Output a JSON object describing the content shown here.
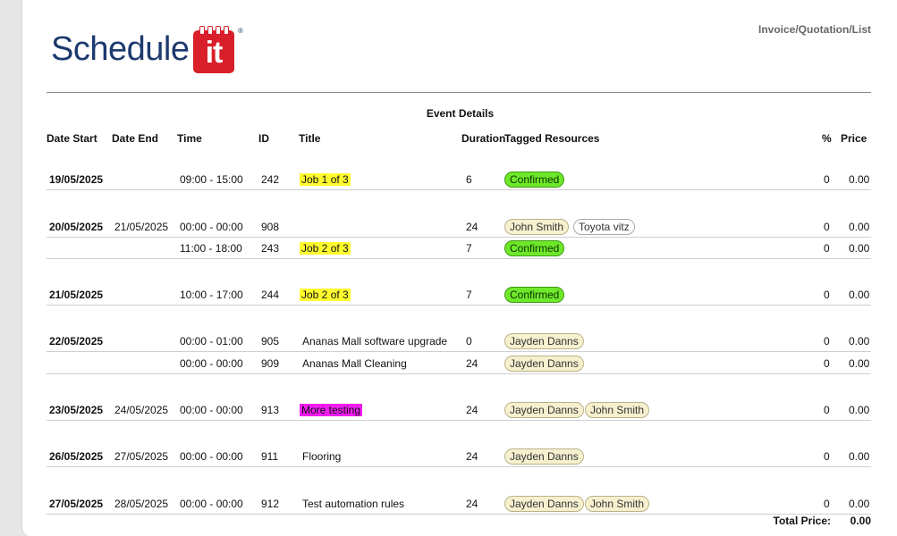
{
  "header": {
    "doc_type": "Invoice/Quotation/List",
    "logo_text": "Schedule",
    "logo_box_text": "it",
    "logo_reg": "®"
  },
  "section_title": "Event Details",
  "columns": {
    "date_start": "Date Start",
    "date_end": "Date End",
    "time": "Time",
    "id": "ID",
    "title": "Title",
    "duration": "Duration",
    "tagged": "Tagged Resources",
    "pct": "%",
    "price": "Price"
  },
  "rows": [
    {
      "date_start": "19/05/2025",
      "date_end": "",
      "time": "09:00 - 15:00",
      "id": "242",
      "title": "Job 1 of 3",
      "title_hl": "yellow",
      "duration": "6",
      "tags": [
        {
          "text": "Confirmed",
          "style": "green"
        }
      ],
      "pct": "0",
      "price": "0.00"
    },
    {
      "date_start": "20/05/2025",
      "date_end": "21/05/2025",
      "time": "00:00 - 00:00",
      "id": "908",
      "title": "",
      "title_hl": "",
      "duration": "24",
      "tags": [
        {
          "text": "John Smith",
          "style": "beige"
        },
        {
          "text": "Toyota vitz",
          "style": "white"
        }
      ],
      "pct": "0",
      "price": "0.00"
    },
    {
      "date_start": "",
      "date_end": "",
      "time": "11:00 - 18:00",
      "id": "243",
      "title": "Job 2 of 3",
      "title_hl": "yellow",
      "duration": "7",
      "tags": [
        {
          "text": "Confirmed",
          "style": "green"
        }
      ],
      "pct": "0",
      "price": "0.00"
    },
    {
      "date_start": "21/05/2025",
      "date_end": "",
      "time": "10:00 - 17:00",
      "id": "244",
      "title": "Job 2 of 3",
      "title_hl": "yellow",
      "duration": "7",
      "tags": [
        {
          "text": "Confirmed",
          "style": "green"
        }
      ],
      "pct": "0",
      "price": "0.00"
    },
    {
      "date_start": "22/05/2025",
      "date_end": "",
      "time": "00:00 - 01:00",
      "id": "905",
      "title": "Ananas Mall software upgrade",
      "title_hl": "",
      "duration": "0",
      "tags": [
        {
          "text": "Jayden Danns",
          "style": "beige"
        }
      ],
      "pct": "0",
      "price": "0.00"
    },
    {
      "date_start": "",
      "date_end": "",
      "time": "00:00 - 00:00",
      "id": "909",
      "title": "Ananas Mall Cleaning",
      "title_hl": "",
      "duration": "24",
      "tags": [
        {
          "text": "Jayden Danns",
          "style": "beige"
        }
      ],
      "pct": "0",
      "price": "0.00"
    },
    {
      "date_start": "23/05/2025",
      "date_end": "24/05/2025",
      "time": "00:00 - 00:00",
      "id": "913",
      "title": "More testing",
      "title_hl": "magenta",
      "duration": "24",
      "tags": [
        {
          "text": "Jayden Danns",
          "style": "beige"
        },
        {
          "text": "John Smith",
          "style": "beige"
        }
      ],
      "pct": "0",
      "price": "0.00"
    },
    {
      "date_start": "26/05/2025",
      "date_end": "27/05/2025",
      "time": "00:00 - 00:00",
      "id": "911",
      "title": "Flooring",
      "title_hl": "",
      "duration": "24",
      "tags": [
        {
          "text": "Jayden Danns",
          "style": "beige"
        }
      ],
      "pct": "0",
      "price": "0.00"
    },
    {
      "date_start": "27/05/2025",
      "date_end": "28/05/2025",
      "time": "00:00 - 00:00",
      "id": "912",
      "title": "Test automation rules",
      "title_hl": "",
      "duration": "24",
      "tags": [
        {
          "text": "Jayden Danns",
          "style": "beige"
        },
        {
          "text": "John Smith",
          "style": "beige"
        }
      ],
      "pct": "0",
      "price": "0.00"
    }
  ],
  "total": {
    "label": "Total Price:",
    "value": "0.00"
  },
  "colors": {
    "highlight_yellow": "#fffb2e",
    "highlight_magenta": "#f01cf0",
    "confirmed_green": "#6ee82a",
    "tag_beige": "#f6f0cf",
    "logo_red": "#d81f2a",
    "logo_blue": "#1d3a6e"
  }
}
